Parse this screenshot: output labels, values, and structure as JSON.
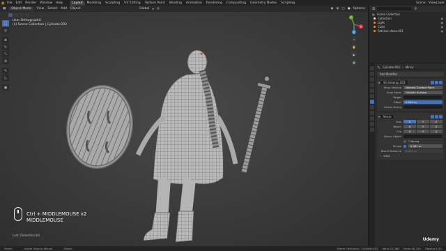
{
  "menu_bar": {
    "items": [
      "File",
      "Edit",
      "Render",
      "Window",
      "Help"
    ],
    "workspaces": [
      "Layout",
      "Modeling",
      "Sculpting",
      "UV Editing",
      "Texture Paint",
      "Shading",
      "Animation",
      "Rendering",
      "Compositing",
      "Geometry Nodes",
      "Scripting"
    ],
    "active_workspace": "Layout",
    "scene": "Scene",
    "view_layer": "ViewLayer"
  },
  "viewport_header": {
    "mode": "Object Mode",
    "menus": [
      "View",
      "Select",
      "Add",
      "Object"
    ],
    "orientation": "Global",
    "options": "Options"
  },
  "viewport": {
    "view_name": "User Orthographic",
    "collection_path": "(4) Scene Collection | Cylinder.003",
    "gizmo_labels": [
      "X",
      "Y",
      "Z"
    ],
    "keycast_line1": "Ctrl + MIDDLEMOUSE x2",
    "keycast_line2": "MIDDLEMOUSE",
    "last_operator": "Last: [Selection] All"
  },
  "outliner": {
    "root": "Scene Collection",
    "rows": [
      {
        "label": "Collection",
        "selected": false
      },
      {
        "label": "Light",
        "selected": false
      },
      {
        "label": "Cube",
        "selected": false
      },
      {
        "label": "Refcase stone.001",
        "selected": false
      }
    ]
  },
  "properties": {
    "object_name": "Cylinder.003",
    "modifier_tab": "Mirror",
    "add_modifier": "Add Modifier",
    "shrinkwrap": {
      "name": "Shrinkwrap.003",
      "wrap_method_label": "Wrap Method",
      "wrap_method": "Nearest Surface Point",
      "snap_mode_label": "Snap Mode",
      "snap_mode": "Outside Surface",
      "target_label": "Target",
      "target": "",
      "offset_label": "Offset",
      "offset": "0.004 m",
      "vertex_group_label": "Vertex Group",
      "vertex_group": ""
    },
    "mirror": {
      "name": "Mirror",
      "axis_label": "Axis",
      "bisect_label": "Bisect",
      "flip_label": "Flip",
      "axes": [
        "X",
        "Y",
        "Z"
      ],
      "mirror_object_label": "Mirror Object",
      "clipping_label": "Clipping",
      "merge_label": "Merge",
      "merge_value": "0.001 m",
      "bisect_distance_label": "Bisect Distance",
      "bisect_distance": "0.001 m",
      "data_label": "Data"
    }
  },
  "status_bar": {
    "items": [
      "Select",
      "Center View to Mouse",
      "Object"
    ],
    "stats": [
      "Scene Collection | Cylinder.003",
      "Verts:25,388",
      "Faces:48,320",
      "Objects:1/12"
    ]
  },
  "watermark": "Udemy",
  "colors": {
    "accent": "#4772b3",
    "background": "#3a3a3a",
    "panel": "#2c2c2c",
    "orange": "#e87d0d"
  }
}
